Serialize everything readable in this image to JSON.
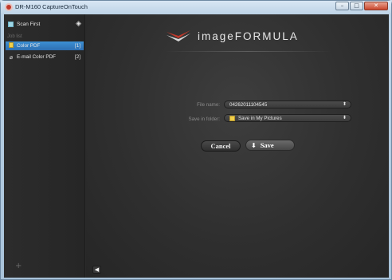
{
  "window": {
    "title": "DR-M160 CaptureOnTouch",
    "minimize": "–",
    "maximize": "□",
    "close": "✕"
  },
  "sidebar": {
    "scan_first": {
      "label": "Scan First",
      "icon": "scan-icon"
    },
    "job_list_label": "Job list",
    "jobs": [
      {
        "label": "Color PDF",
        "number": "[1]",
        "icon": "pdf-icon",
        "selected": true
      },
      {
        "label": "E-mail Color PDF",
        "number": "[2]",
        "icon": "paperclip-icon",
        "selected": false
      }
    ],
    "add": "+"
  },
  "main": {
    "brand": "imageFORMULA",
    "form": {
      "file_name_label": "File name:",
      "file_name_value": "04262011104545",
      "save_folder_label": "Save in folder:",
      "save_folder_value": "Save in My Pictures"
    },
    "cancel_label": "Cancel",
    "save_label": "Save",
    "back": "◀"
  },
  "colors": {
    "selection": "#3a86cc",
    "background": "#2b2b2b",
    "folder": "#f1cf4b"
  }
}
